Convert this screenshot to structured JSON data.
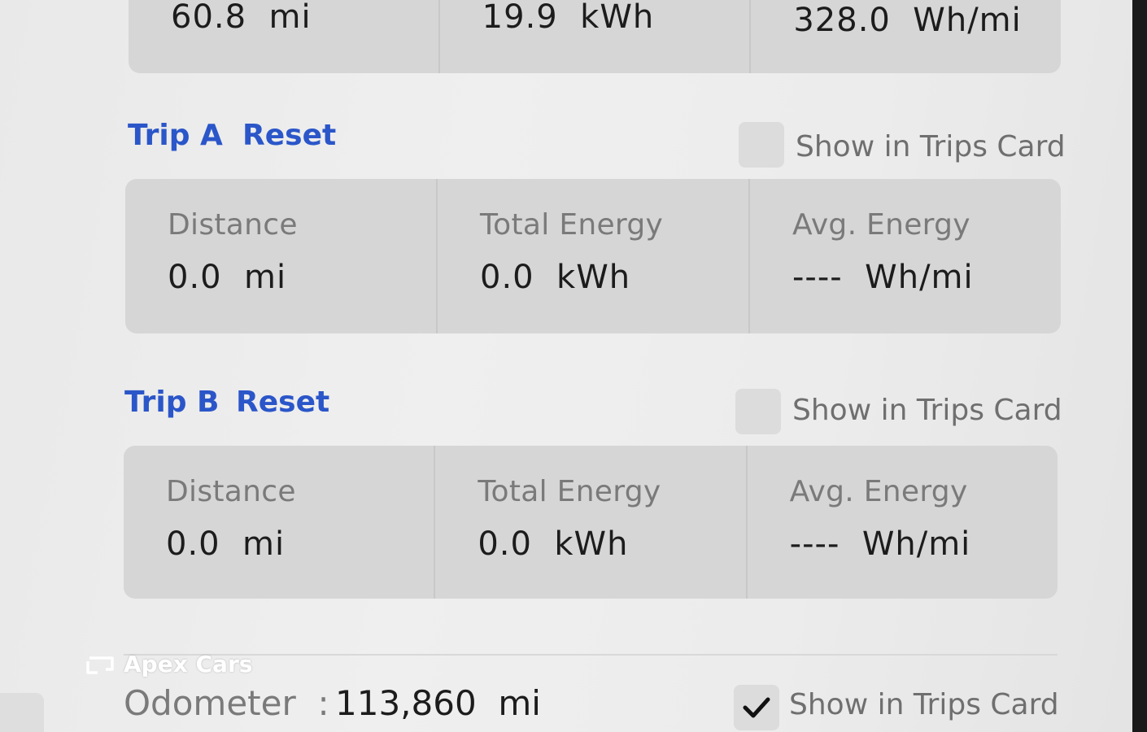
{
  "since_last_charge": {
    "distance": "60.8  mi",
    "total_energy": "19.9  kWh",
    "avg_energy": "328.0  Wh/mi"
  },
  "trip_a": {
    "title": "Trip A",
    "reset_label": "Reset",
    "show_label": "Show in Trips Card",
    "show_checked": false,
    "distance_label": "Distance",
    "distance_value": "0.0  mi",
    "energy_label": "Total Energy",
    "energy_value": "0.0  kWh",
    "avg_label": "Avg. Energy",
    "avg_value": "----  Wh/mi"
  },
  "trip_b": {
    "title": "Trip B",
    "reset_label": "Reset",
    "show_label": "Show in Trips Card",
    "show_checked": false,
    "distance_label": "Distance",
    "distance_value": "0.0  mi",
    "energy_label": "Total Energy",
    "energy_value": "0.0  kWh",
    "avg_label": "Avg. Energy",
    "avg_value": "----  Wh/mi"
  },
  "odometer": {
    "label": "Odometer  :",
    "value": "113,860  mi",
    "show_label": "Show in Trips Card",
    "show_checked": true
  },
  "watermark": {
    "text": "Apex Cars",
    "icon": "car-screen-logo-icon"
  },
  "colors": {
    "accent": "#2b56c9",
    "card": "#d6d6d6",
    "background": "#ececec"
  }
}
